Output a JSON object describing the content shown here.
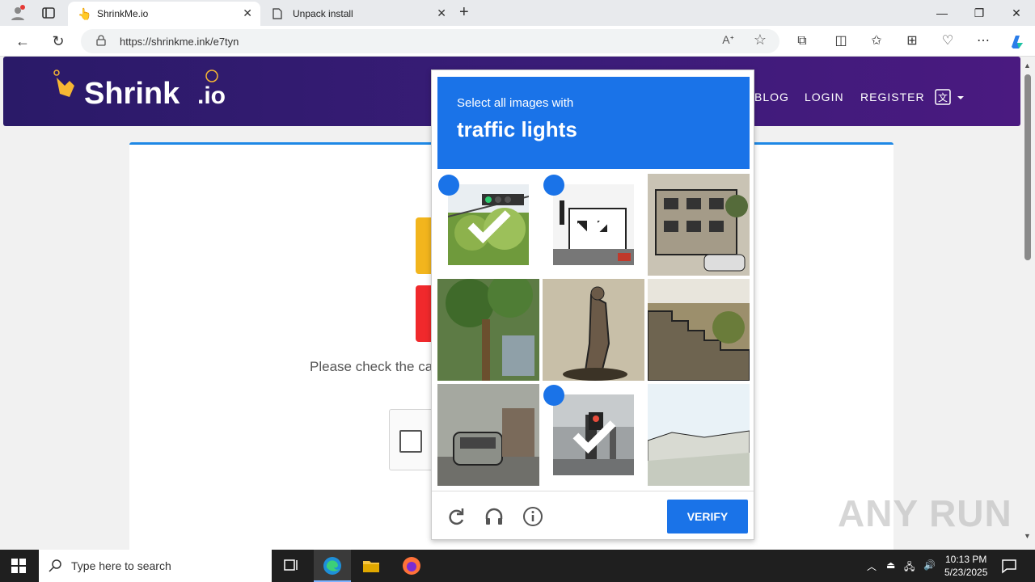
{
  "browser": {
    "tabs": [
      {
        "label": "ShrinkMe.io",
        "active": true
      },
      {
        "label": "Unpack install",
        "active": false
      }
    ],
    "url": "https://shrinkme.ink/e7tyn"
  },
  "site": {
    "logo_text": "ShrinkMe.io",
    "nav": {
      "blog": "BLOG",
      "login": "LOGIN",
      "register": "REGISTER"
    },
    "message": "Please check the ca"
  },
  "captcha": {
    "instruction": "Select all images with",
    "target": "traffic lights",
    "tiles": [
      {
        "name": "traffic-light-trees",
        "selected": true
      },
      {
        "name": "street-building",
        "selected": true
      },
      {
        "name": "apartment-building",
        "selected": false
      },
      {
        "name": "palm-tree",
        "selected": false
      },
      {
        "name": "statue",
        "selected": false
      },
      {
        "name": "stairs-hillside",
        "selected": false
      },
      {
        "name": "street-cars",
        "selected": false
      },
      {
        "name": "pedestrian-signal",
        "selected": true
      },
      {
        "name": "coastline",
        "selected": false
      }
    ],
    "verify_label": "VERIFY"
  },
  "watermark": "ANY RUN",
  "taskbar": {
    "search_placeholder": "Type here to search",
    "time": "10:13 PM",
    "date": "5/23/2025"
  },
  "colors": {
    "accent": "#1a73e8",
    "header": "#3a1c78"
  }
}
